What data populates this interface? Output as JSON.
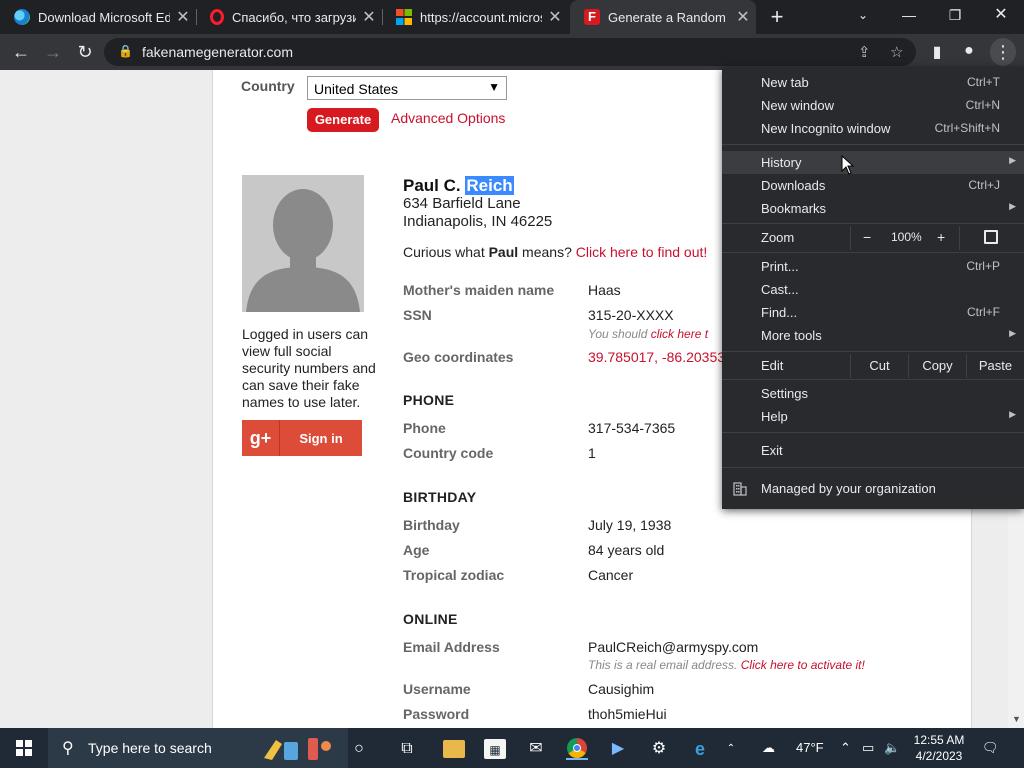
{
  "browser": {
    "tabs": [
      {
        "title": "Download Microsoft Ed",
        "icon": "edge-icon"
      },
      {
        "title": "Спасибо, что загрузил",
        "icon": "opera-icon"
      },
      {
        "title": "https://account.micros",
        "icon": "microsoft-icon"
      },
      {
        "title": "Generate a Random Na",
        "icon": "fakename-icon",
        "active": true
      }
    ],
    "url": "fakenamegenerator.com"
  },
  "form": {
    "country_label": "Country",
    "country_value": "United States",
    "generate_label": "Generate",
    "advanced_label": "Advanced Options"
  },
  "sidebar": {
    "login_text": "Logged in users can view full social security numbers and can save their fake names to use later.",
    "signin_label": "Sign in",
    "gplus_glyph": "g+"
  },
  "identity": {
    "name_first": "Paul C.",
    "name_last": "Reich",
    "address_line1": "634 Barfield Lane",
    "address_line2": "Indianapolis, IN 46225",
    "curious_prefix": "Curious what ",
    "curious_name": "Paul",
    "curious_mid": " means? ",
    "curious_link": "Click here to find out!"
  },
  "details": {
    "maiden_label": "Mother's maiden name",
    "maiden_value": "Haas",
    "ssn_label": "SSN",
    "ssn_value": "315-20-XXXX",
    "ssn_note_prefix": "You should ",
    "ssn_note_link": "click here t",
    "geo_label": "Geo coordinates",
    "geo_value": "39.785017, -86.20353",
    "phone_section": "PHONE",
    "phone_label": "Phone",
    "phone_value": "317-534-7365",
    "cc_label": "Country code",
    "cc_value": "1",
    "birthday_section": "BIRTHDAY",
    "birthday_label": "Birthday",
    "birthday_value": "July 19, 1938",
    "age_label": "Age",
    "age_value": "84 years old",
    "zodiac_label": "Tropical zodiac",
    "zodiac_value": "Cancer",
    "online_section": "ONLINE",
    "email_label": "Email Address",
    "email_value": "PaulCReich@armyspy.com",
    "email_note_prefix": "This is a real email address. ",
    "email_note_link": "Click here to activate it!",
    "username_label": "Username",
    "username_value": "Causighim",
    "password_label": "Password",
    "password_value": "thoh5mieHui"
  },
  "menu": {
    "new_tab": "New tab",
    "new_tab_key": "Ctrl+T",
    "new_window": "New window",
    "new_window_key": "Ctrl+N",
    "incognito": "New Incognito window",
    "incognito_key": "Ctrl+Shift+N",
    "history": "History",
    "downloads": "Downloads",
    "downloads_key": "Ctrl+J",
    "bookmarks": "Bookmarks",
    "zoom": "Zoom",
    "zoom_minus": "−",
    "zoom_value": "100%",
    "zoom_plus": "+",
    "print": "Print...",
    "print_key": "Ctrl+P",
    "cast": "Cast...",
    "find": "Find...",
    "find_key": "Ctrl+F",
    "more_tools": "More tools",
    "edit": "Edit",
    "cut": "Cut",
    "copy": "Copy",
    "paste": "Paste",
    "settings": "Settings",
    "help": "Help",
    "exit": "Exit",
    "managed": "Managed by your organization"
  },
  "taskbar": {
    "search_placeholder": "Type here to search",
    "weather": "47°F",
    "time": "12:55 AM",
    "date": "4/2/2023"
  },
  "colors": {
    "accent_red": "#d71920",
    "link_red": "#c8102e",
    "chrome_dark": "#202124",
    "menu_bg": "#292a2d"
  }
}
